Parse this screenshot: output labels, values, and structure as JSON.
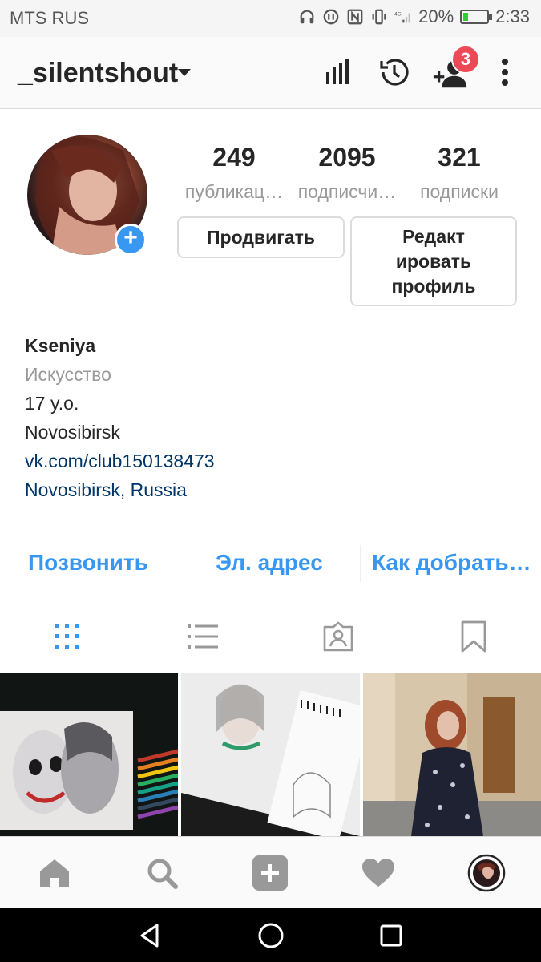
{
  "status_bar": {
    "carrier": "MTS RUS",
    "network": "4G",
    "battery_percent": "20%",
    "battery_level": 0.2,
    "time": "2:33"
  },
  "header": {
    "username": "_silentshout",
    "notification_count": "3",
    "icons": [
      "insights-icon",
      "archive-history-icon",
      "discover-people-icon",
      "more-options-icon"
    ]
  },
  "profile": {
    "stats": [
      {
        "value": "249",
        "label": "публикац…"
      },
      {
        "value": "2095",
        "label": "подписчи…"
      },
      {
        "value": "321",
        "label": "подписки"
      }
    ],
    "promote_label": "Продвигать",
    "edit_profile_label": [
      "Редакт",
      "ировать",
      "профиль"
    ]
  },
  "bio": {
    "name": "Kseniya",
    "category": "Искусство",
    "line1": "17 y.o.",
    "line2": "Novosibirsk",
    "link": "vk.com/club150138473",
    "location": "Novosibirsk, Russia"
  },
  "contact": {
    "call": "Позвонить",
    "email": "Эл. адрес",
    "directions": "Как добрать…"
  },
  "tabs": [
    "grid-view-icon",
    "list-view-icon",
    "tagged-icon",
    "saved-icon"
  ],
  "colors": {
    "accent": "#3897f0",
    "badge": "#ed4956",
    "link": "#003569",
    "muted": "#999999"
  },
  "bottom_nav": [
    "home-icon",
    "search-icon",
    "new-post-icon",
    "activity-icon",
    "profile-icon"
  ]
}
